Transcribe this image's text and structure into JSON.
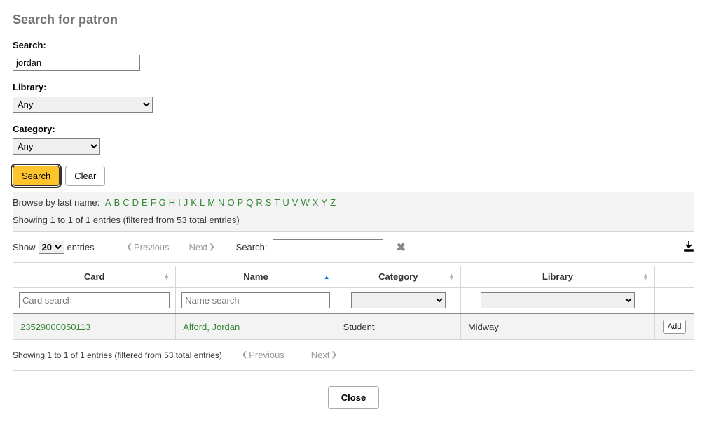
{
  "title": "Search for patron",
  "form": {
    "search_label": "Search:",
    "search_value": "jordan",
    "library_label": "Library:",
    "library_value": "Any",
    "category_label": "Category:",
    "category_value": "Any",
    "search_button": "Search",
    "clear_button": "Clear"
  },
  "browse": {
    "label": "Browse by last name:",
    "letters": [
      "A",
      "B",
      "C",
      "D",
      "E",
      "F",
      "G",
      "H",
      "I",
      "J",
      "K",
      "L",
      "M",
      "N",
      "O",
      "P",
      "Q",
      "R",
      "S",
      "T",
      "U",
      "V",
      "W",
      "X",
      "Y",
      "Z"
    ]
  },
  "results_info": "Showing 1 to 1 of 1 entries (filtered from 53 total entries)",
  "controls": {
    "show_label": "Show",
    "entries_label": "entries",
    "show_value": "20",
    "previous": "Previous",
    "next": "Next",
    "search_label": "Search:"
  },
  "columns": {
    "card": "Card",
    "name": "Name",
    "category": "Category",
    "library": "Library"
  },
  "filters": {
    "card_placeholder": "Card search",
    "name_placeholder": "Name search"
  },
  "rows": [
    {
      "card": "23529000050113",
      "name": "Alford, Jordan",
      "category": "Student",
      "library": "Midway"
    }
  ],
  "add_label": "Add",
  "close_label": "Close"
}
